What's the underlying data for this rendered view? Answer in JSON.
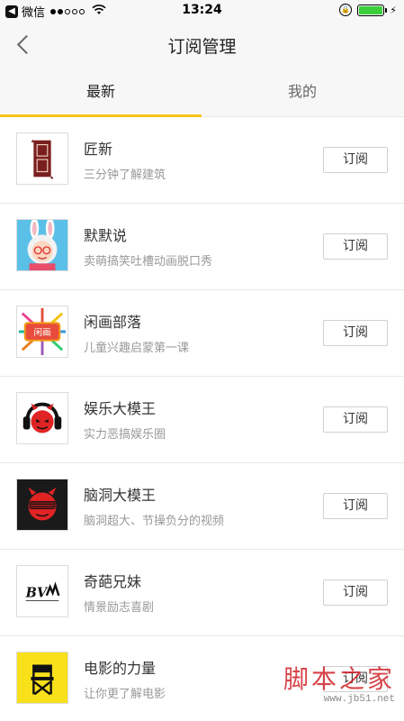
{
  "status_bar": {
    "carrier": "微信",
    "time": "13:24"
  },
  "nav": {
    "title": "订阅管理"
  },
  "tabs": [
    {
      "label": "最新",
      "active": true
    },
    {
      "label": "我的",
      "active": false
    }
  ],
  "items": [
    {
      "name": "匠新",
      "desc": "三分钟了解建筑",
      "button": "订阅",
      "avatar_icon": "red-seal-icon"
    },
    {
      "name": "默默说",
      "desc": "卖萌搞笑吐槽动画脱口秀",
      "button": "订阅",
      "avatar_icon": "bunny-granny-icon"
    },
    {
      "name": "闲画部落",
      "desc": "儿童兴趣启蒙第一课",
      "button": "订阅",
      "avatar_icon": "colorful-badge-icon"
    },
    {
      "name": "娱乐大模王",
      "desc": "实力恶搞娱乐圈",
      "button": "订阅",
      "avatar_icon": "devil-headphones-icon"
    },
    {
      "name": "脑洞大模王",
      "desc": "脑洞超大、节操负分的视频",
      "button": "订阅",
      "avatar_icon": "devil-shades-icon"
    },
    {
      "name": "奇葩兄妹",
      "desc": "情景励志喜剧",
      "button": "订阅",
      "avatar_icon": "bvm-logo-icon"
    },
    {
      "name": "电影的力量",
      "desc": "让你更了解电影",
      "button": "订阅",
      "avatar_icon": "director-chair-icon"
    }
  ],
  "watermark": {
    "main": "脚本之家",
    "sub": "www.jb51.net"
  },
  "colors": {
    "accent": "#f5c518",
    "nav_bg": "#f7f7f7",
    "watermark": "#d1242a"
  }
}
